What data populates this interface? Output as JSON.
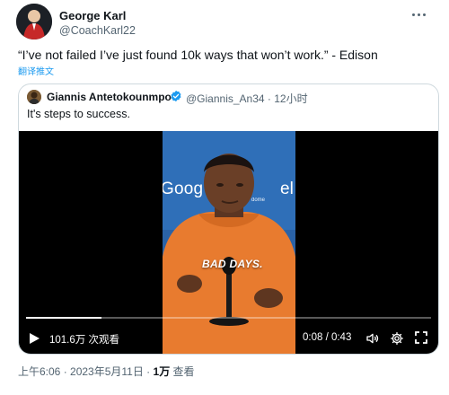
{
  "author": {
    "name": "George Karl",
    "handle": "@CoachKarl22"
  },
  "tweet": {
    "text": "“I’ve not failed I’ve just found 10k ways that won’t work.” - Edison",
    "translate_label": "翻译推文"
  },
  "quoted": {
    "name": "Giannis Antetokounmpo",
    "handle_time": "@Giannis_An34 · 12小时",
    "text": "It's steps to success.",
    "verified_color": "#1d9bf0"
  },
  "video": {
    "backdrop_word_left": "Goog",
    "backdrop_word_right": "el",
    "backdrop_small": "dome",
    "caption": "BAD DAYS.",
    "views": "101.6万 次观看",
    "time": "0:08 / 0:43",
    "progress": 0.186
  },
  "meta": {
    "time_date": "上午6:06 · 2023年5月11日 · ",
    "views_count": "1万",
    "views_label": " 查看"
  },
  "colors": {
    "accent": "#1d9bf0",
    "text": "#0f1419",
    "muted": "#536471",
    "border": "#cfd9de",
    "video_backdrop": "#2f6fb8"
  },
  "icons": [
    "more-icon",
    "verified-icon",
    "play-icon",
    "volume-icon",
    "gear-icon",
    "fullscreen-icon"
  ]
}
